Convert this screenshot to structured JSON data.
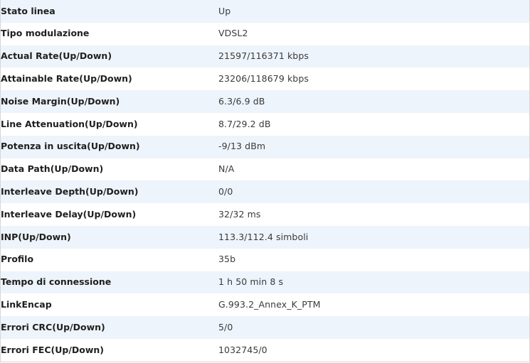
{
  "line_status": {
    "rows": [
      {
        "label": "Stato linea",
        "value": "Up"
      },
      {
        "label": "Tipo modulazione",
        "value": "VDSL2"
      },
      {
        "label": "Actual Rate(Up/Down)",
        "value": "21597/116371 kbps"
      },
      {
        "label": "Attainable Rate(Up/Down)",
        "value": "23206/118679 kbps"
      },
      {
        "label": "Noise Margin(Up/Down)",
        "value": "6.3/6.9 dB"
      },
      {
        "label": "Line Attenuation(Up/Down)",
        "value": "8.7/29.2 dB"
      },
      {
        "label": "Potenza in uscita(Up/Down)",
        "value": "-9/13 dBm"
      },
      {
        "label": "Data Path(Up/Down)",
        "value": "N/A"
      },
      {
        "label": "Interleave Depth(Up/Down)",
        "value": "0/0"
      },
      {
        "label": "Interleave Delay(Up/Down)",
        "value": "32/32 ms"
      },
      {
        "label": "INP(Up/Down)",
        "value": "113.3/112.4 simboli"
      },
      {
        "label": "Profilo",
        "value": "35b"
      },
      {
        "label": "Tempo di connessione",
        "value": "1 h 50 min 8 s"
      },
      {
        "label": "LinkEncap",
        "value": "G.993.2_Annex_K_PTM"
      },
      {
        "label": "Errori CRC(Up/Down)",
        "value": "5/0"
      },
      {
        "label": "Errori FEC(Up/Down)",
        "value": "1032745/0"
      }
    ]
  },
  "colors": {
    "stripe_row": "#eef4fb",
    "plain_row": "#ffffff",
    "label_text": "#1f1f1f",
    "value_text": "#3a3a3a"
  }
}
